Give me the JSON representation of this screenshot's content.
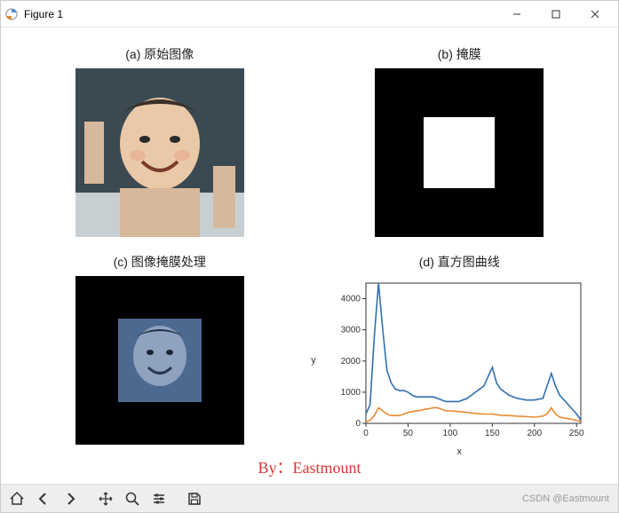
{
  "window": {
    "title": "Figure 1"
  },
  "panels": {
    "a": {
      "title": "(a) 原始图像"
    },
    "b": {
      "title": "(b) 掩膜"
    },
    "c": {
      "title": "(c) 图像掩膜处理"
    },
    "d": {
      "title": "(d) 直方图曲线"
    }
  },
  "byline": "By：Eastmount",
  "watermark": "CSDN @Eastmount",
  "toolbar": {
    "home": "Home",
    "back": "Back",
    "forward": "Forward",
    "pan": "Pan",
    "zoom": "Zoom",
    "configure": "Configure",
    "save": "Save"
  },
  "chart_data": {
    "type": "line",
    "title": "(d) 直方图曲线",
    "xlabel": "x",
    "ylabel": "y",
    "xlim": [
      0,
      255
    ],
    "ylim": [
      0,
      4500
    ],
    "xticks": [
      0,
      50,
      100,
      150,
      200,
      250
    ],
    "yticks": [
      0,
      1000,
      2000,
      3000,
      4000
    ],
    "x": [
      0,
      5,
      10,
      15,
      20,
      25,
      30,
      35,
      40,
      45,
      50,
      55,
      60,
      65,
      70,
      75,
      80,
      85,
      90,
      95,
      100,
      110,
      120,
      130,
      140,
      145,
      150,
      155,
      160,
      170,
      180,
      190,
      200,
      210,
      215,
      220,
      225,
      230,
      240,
      250,
      255
    ],
    "series": [
      {
        "name": "blue",
        "color": "#2f6fb1",
        "values": [
          300,
          600,
          2800,
          4500,
          3000,
          1700,
          1300,
          1100,
          1050,
          1050,
          1000,
          900,
          850,
          850,
          850,
          850,
          850,
          800,
          750,
          700,
          700,
          700,
          800,
          1000,
          1200,
          1500,
          1800,
          1300,
          1100,
          900,
          800,
          750,
          750,
          800,
          1200,
          1600,
          1200,
          900,
          600,
          300,
          100
        ]
      },
      {
        "name": "orange",
        "color": "#e98a2e",
        "values": [
          50,
          100,
          250,
          500,
          400,
          300,
          250,
          250,
          250,
          300,
          350,
          380,
          400,
          420,
          450,
          470,
          500,
          500,
          450,
          400,
          400,
          380,
          350,
          320,
          300,
          300,
          300,
          280,
          260,
          250,
          230,
          220,
          200,
          230,
          300,
          500,
          300,
          200,
          150,
          100,
          50
        ]
      }
    ]
  }
}
